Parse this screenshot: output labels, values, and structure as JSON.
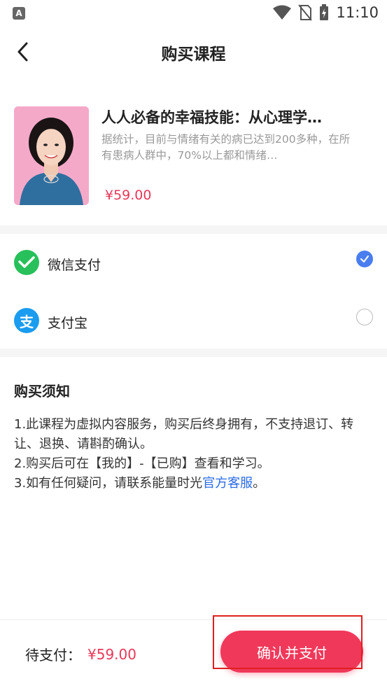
{
  "status_bar": {
    "time": "11:10",
    "app_icon_letter": "A",
    "icons": [
      "wifi-icon",
      "no-sim-icon",
      "battery-charging-icon"
    ]
  },
  "nav": {
    "title": "购买课程",
    "back_icon": "chevron-left-icon"
  },
  "course": {
    "title": "人人必备的幸福技能：从心理学…",
    "description": "据统计，目前与情绪有关的病已达到200多种，在所有患病人群中，70%以上都和情绪…",
    "price": "¥59.00"
  },
  "payment_methods": [
    {
      "label": "微信支付",
      "icon": "wechat-pay-icon",
      "selected": true,
      "color": "#27c05b"
    },
    {
      "label": "支付宝",
      "icon": "alipay-icon",
      "selected": false,
      "color": "#1a9cf0"
    }
  ],
  "notice": {
    "title": "购买须知",
    "line1": "1.此课程为虚拟内容服务，购买后终身拥有，不支持退订、转让、退换、请斟酌确认。",
    "line2": "2.购买后可在【我的】-【已购】查看和学习。",
    "line3_prefix": "3.如有任何疑问，请联系能量时光",
    "line3_link": "官方客服",
    "line3_suffix": "。"
  },
  "bottom_bar": {
    "pending_label": "待支付：",
    "pending_amount": "¥59.00",
    "pay_button_label": "确认并支付"
  },
  "colors": {
    "accent_red": "#f0385a",
    "price_red": "#e8385a",
    "link_blue": "#2a6be8",
    "radio_blue": "#4a7ef0"
  }
}
